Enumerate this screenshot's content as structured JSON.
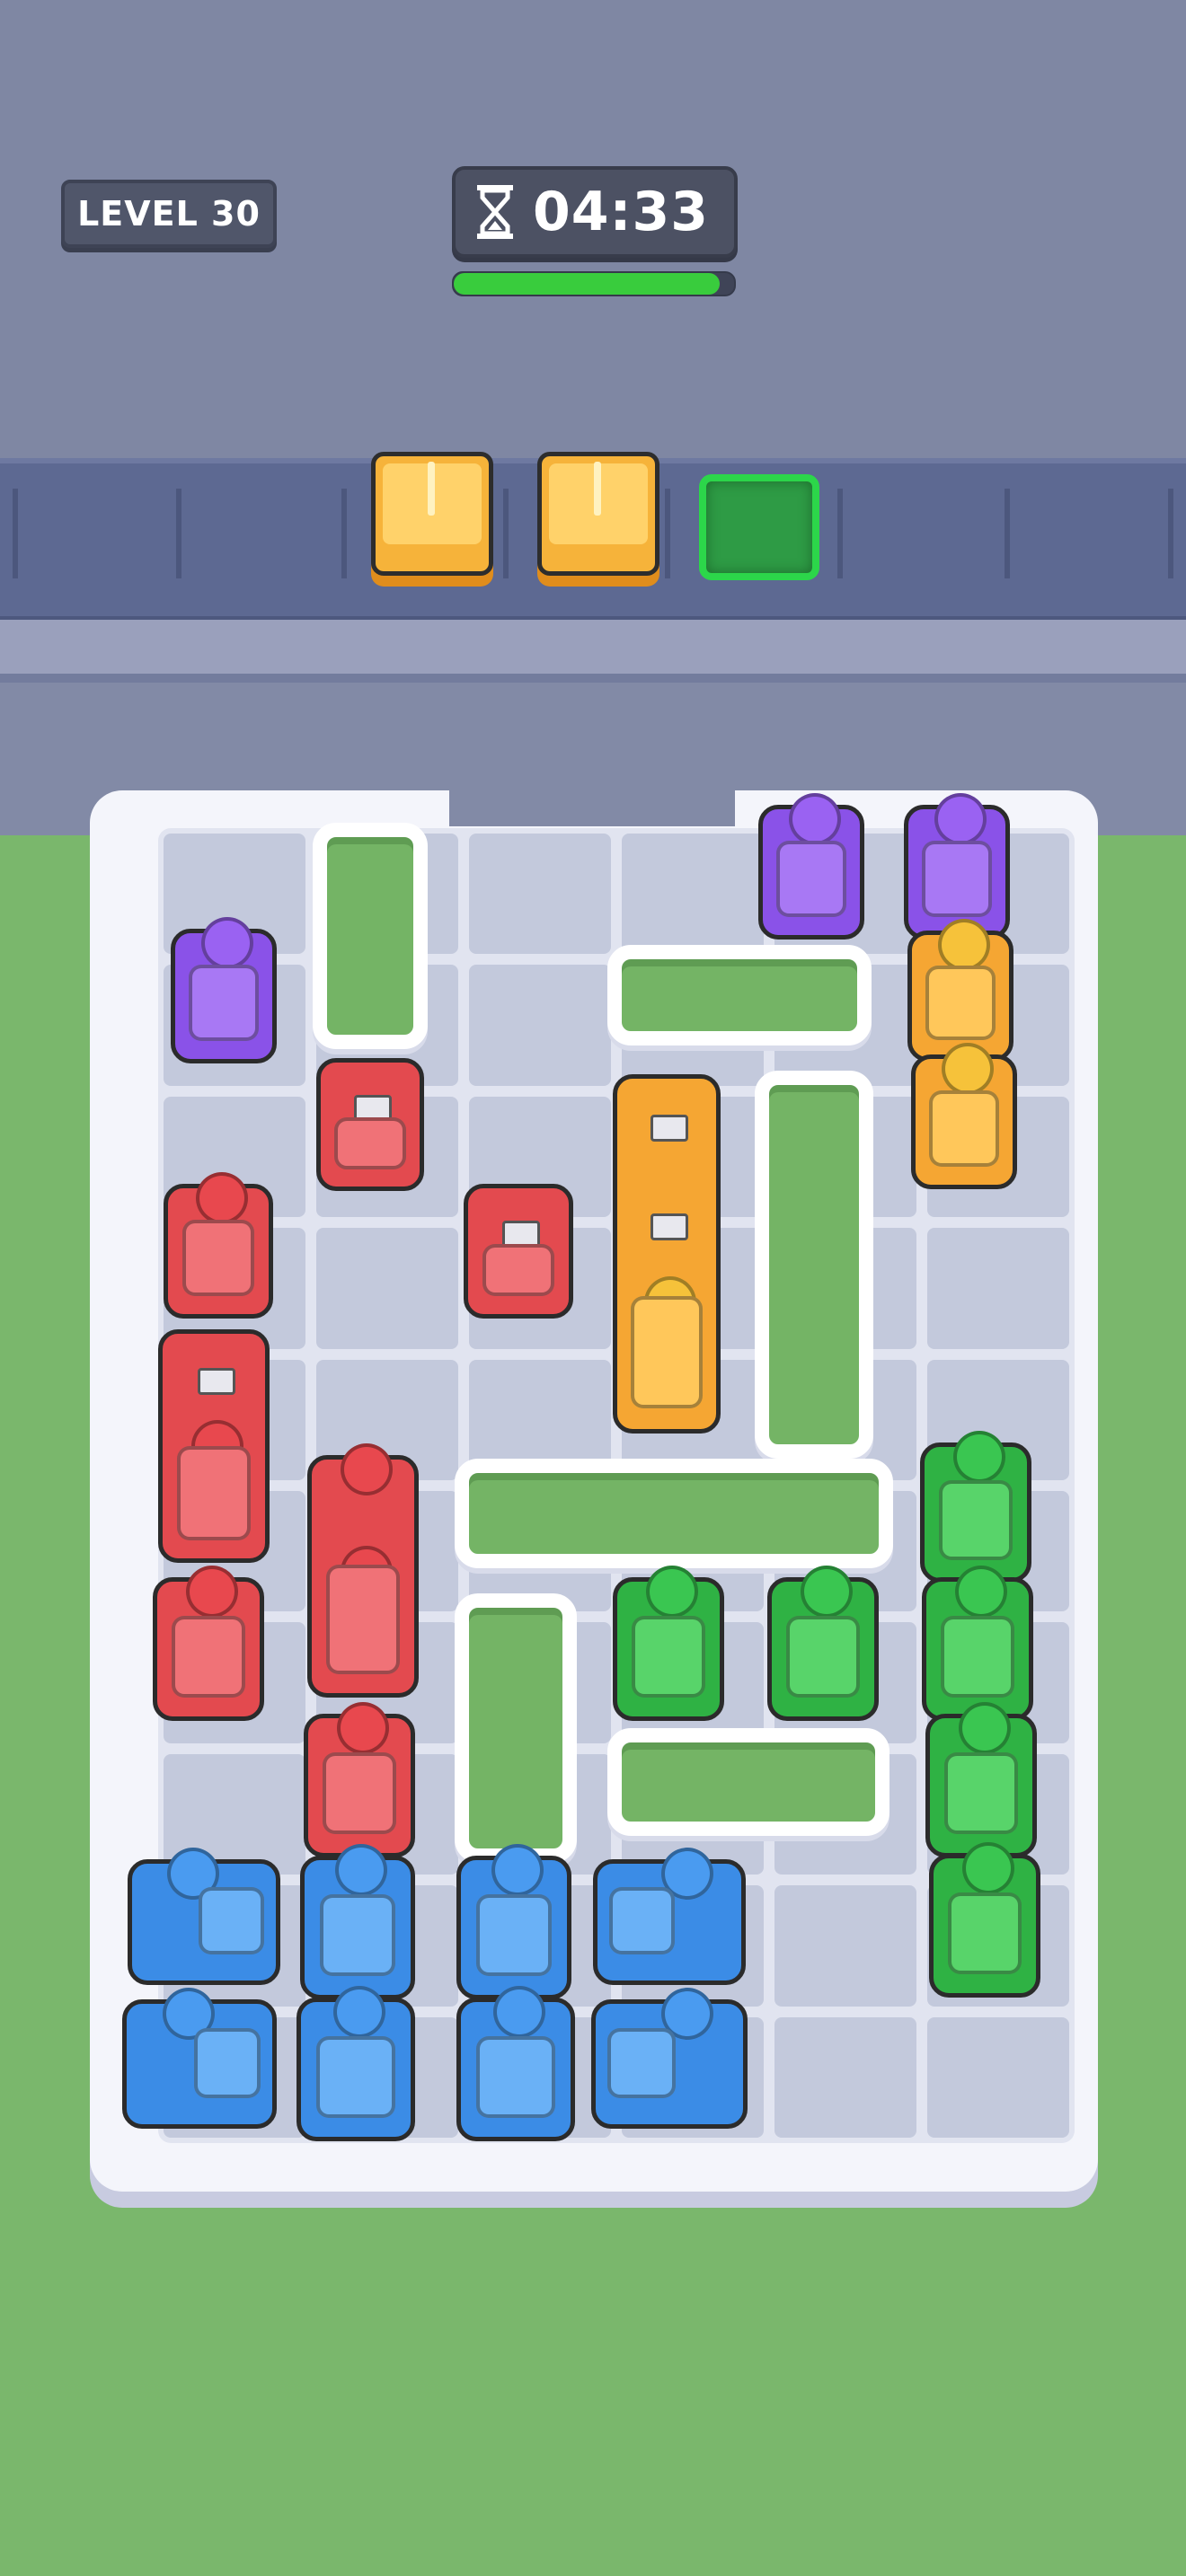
{
  "hud": {
    "level_label": "LEVEL 30",
    "timer": "04:33",
    "timer_progress": 0.95
  },
  "queue": {
    "slots": [
      "orange",
      "orange",
      "empty-green"
    ]
  },
  "colors": {
    "purple": "#8a52e8",
    "orange": "#f5a633",
    "red": "#e34a4f",
    "green": "#2fb244",
    "blue": "#3b8ce6",
    "progress": "#39cc3d"
  }
}
